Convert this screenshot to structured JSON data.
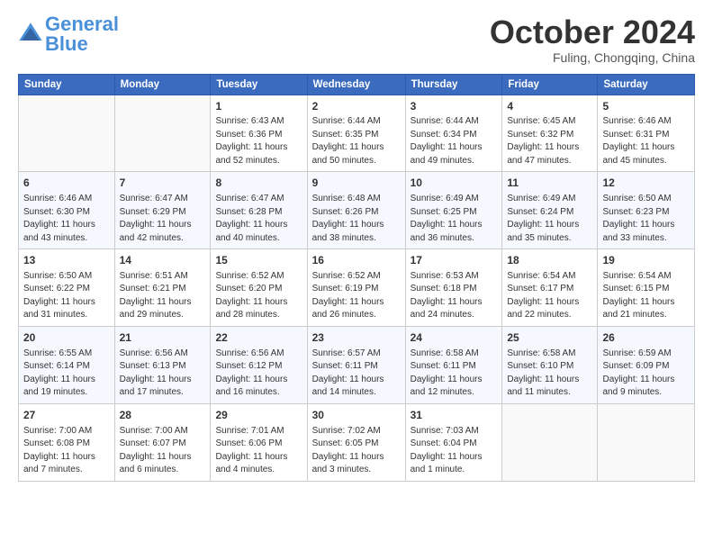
{
  "header": {
    "logo_general": "General",
    "logo_blue": "Blue",
    "month_title": "October 2024",
    "location": "Fuling, Chongqing, China"
  },
  "days_of_week": [
    "Sunday",
    "Monday",
    "Tuesday",
    "Wednesday",
    "Thursday",
    "Friday",
    "Saturday"
  ],
  "weeks": [
    [
      {
        "day": "",
        "info": ""
      },
      {
        "day": "",
        "info": ""
      },
      {
        "day": "1",
        "info": "Sunrise: 6:43 AM\nSunset: 6:36 PM\nDaylight: 11 hours\nand 52 minutes."
      },
      {
        "day": "2",
        "info": "Sunrise: 6:44 AM\nSunset: 6:35 PM\nDaylight: 11 hours\nand 50 minutes."
      },
      {
        "day": "3",
        "info": "Sunrise: 6:44 AM\nSunset: 6:34 PM\nDaylight: 11 hours\nand 49 minutes."
      },
      {
        "day": "4",
        "info": "Sunrise: 6:45 AM\nSunset: 6:32 PM\nDaylight: 11 hours\nand 47 minutes."
      },
      {
        "day": "5",
        "info": "Sunrise: 6:46 AM\nSunset: 6:31 PM\nDaylight: 11 hours\nand 45 minutes."
      }
    ],
    [
      {
        "day": "6",
        "info": "Sunrise: 6:46 AM\nSunset: 6:30 PM\nDaylight: 11 hours\nand 43 minutes."
      },
      {
        "day": "7",
        "info": "Sunrise: 6:47 AM\nSunset: 6:29 PM\nDaylight: 11 hours\nand 42 minutes."
      },
      {
        "day": "8",
        "info": "Sunrise: 6:47 AM\nSunset: 6:28 PM\nDaylight: 11 hours\nand 40 minutes."
      },
      {
        "day": "9",
        "info": "Sunrise: 6:48 AM\nSunset: 6:26 PM\nDaylight: 11 hours\nand 38 minutes."
      },
      {
        "day": "10",
        "info": "Sunrise: 6:49 AM\nSunset: 6:25 PM\nDaylight: 11 hours\nand 36 minutes."
      },
      {
        "day": "11",
        "info": "Sunrise: 6:49 AM\nSunset: 6:24 PM\nDaylight: 11 hours\nand 35 minutes."
      },
      {
        "day": "12",
        "info": "Sunrise: 6:50 AM\nSunset: 6:23 PM\nDaylight: 11 hours\nand 33 minutes."
      }
    ],
    [
      {
        "day": "13",
        "info": "Sunrise: 6:50 AM\nSunset: 6:22 PM\nDaylight: 11 hours\nand 31 minutes."
      },
      {
        "day": "14",
        "info": "Sunrise: 6:51 AM\nSunset: 6:21 PM\nDaylight: 11 hours\nand 29 minutes."
      },
      {
        "day": "15",
        "info": "Sunrise: 6:52 AM\nSunset: 6:20 PM\nDaylight: 11 hours\nand 28 minutes."
      },
      {
        "day": "16",
        "info": "Sunrise: 6:52 AM\nSunset: 6:19 PM\nDaylight: 11 hours\nand 26 minutes."
      },
      {
        "day": "17",
        "info": "Sunrise: 6:53 AM\nSunset: 6:18 PM\nDaylight: 11 hours\nand 24 minutes."
      },
      {
        "day": "18",
        "info": "Sunrise: 6:54 AM\nSunset: 6:17 PM\nDaylight: 11 hours\nand 22 minutes."
      },
      {
        "day": "19",
        "info": "Sunrise: 6:54 AM\nSunset: 6:15 PM\nDaylight: 11 hours\nand 21 minutes."
      }
    ],
    [
      {
        "day": "20",
        "info": "Sunrise: 6:55 AM\nSunset: 6:14 PM\nDaylight: 11 hours\nand 19 minutes."
      },
      {
        "day": "21",
        "info": "Sunrise: 6:56 AM\nSunset: 6:13 PM\nDaylight: 11 hours\nand 17 minutes."
      },
      {
        "day": "22",
        "info": "Sunrise: 6:56 AM\nSunset: 6:12 PM\nDaylight: 11 hours\nand 16 minutes."
      },
      {
        "day": "23",
        "info": "Sunrise: 6:57 AM\nSunset: 6:11 PM\nDaylight: 11 hours\nand 14 minutes."
      },
      {
        "day": "24",
        "info": "Sunrise: 6:58 AM\nSunset: 6:11 PM\nDaylight: 11 hours\nand 12 minutes."
      },
      {
        "day": "25",
        "info": "Sunrise: 6:58 AM\nSunset: 6:10 PM\nDaylight: 11 hours\nand 11 minutes."
      },
      {
        "day": "26",
        "info": "Sunrise: 6:59 AM\nSunset: 6:09 PM\nDaylight: 11 hours\nand 9 minutes."
      }
    ],
    [
      {
        "day": "27",
        "info": "Sunrise: 7:00 AM\nSunset: 6:08 PM\nDaylight: 11 hours\nand 7 minutes."
      },
      {
        "day": "28",
        "info": "Sunrise: 7:00 AM\nSunset: 6:07 PM\nDaylight: 11 hours\nand 6 minutes."
      },
      {
        "day": "29",
        "info": "Sunrise: 7:01 AM\nSunset: 6:06 PM\nDaylight: 11 hours\nand 4 minutes."
      },
      {
        "day": "30",
        "info": "Sunrise: 7:02 AM\nSunset: 6:05 PM\nDaylight: 11 hours\nand 3 minutes."
      },
      {
        "day": "31",
        "info": "Sunrise: 7:03 AM\nSunset: 6:04 PM\nDaylight: 11 hours\nand 1 minute."
      },
      {
        "day": "",
        "info": ""
      },
      {
        "day": "",
        "info": ""
      }
    ]
  ]
}
